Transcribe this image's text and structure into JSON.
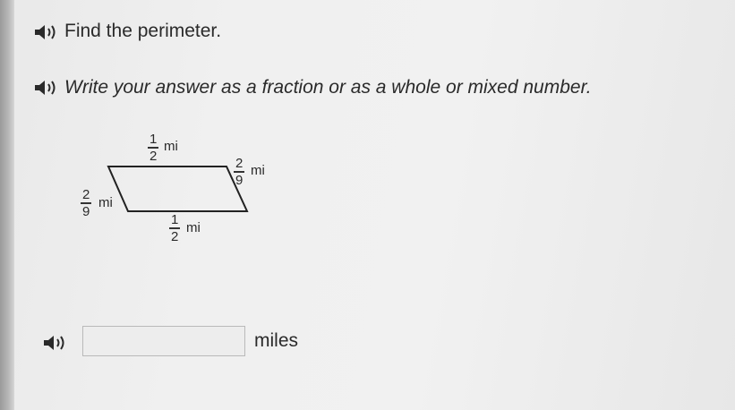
{
  "question": {
    "line1": "Find the perimeter.",
    "line2": "Write your answer as a fraction or as a whole or mixed number."
  },
  "figure": {
    "top_side": {
      "numerator": "1",
      "denominator": "2",
      "unit": "mi"
    },
    "right_side": {
      "numerator": "2",
      "denominator": "9",
      "unit": "mi"
    },
    "left_side": {
      "numerator": "2",
      "denominator": "9",
      "unit": "mi"
    },
    "bottom_side": {
      "numerator": "1",
      "denominator": "2",
      "unit": "mi"
    }
  },
  "answer": {
    "value": "",
    "unit_label": "miles"
  },
  "icons": {
    "speaker": "speaker-icon"
  }
}
